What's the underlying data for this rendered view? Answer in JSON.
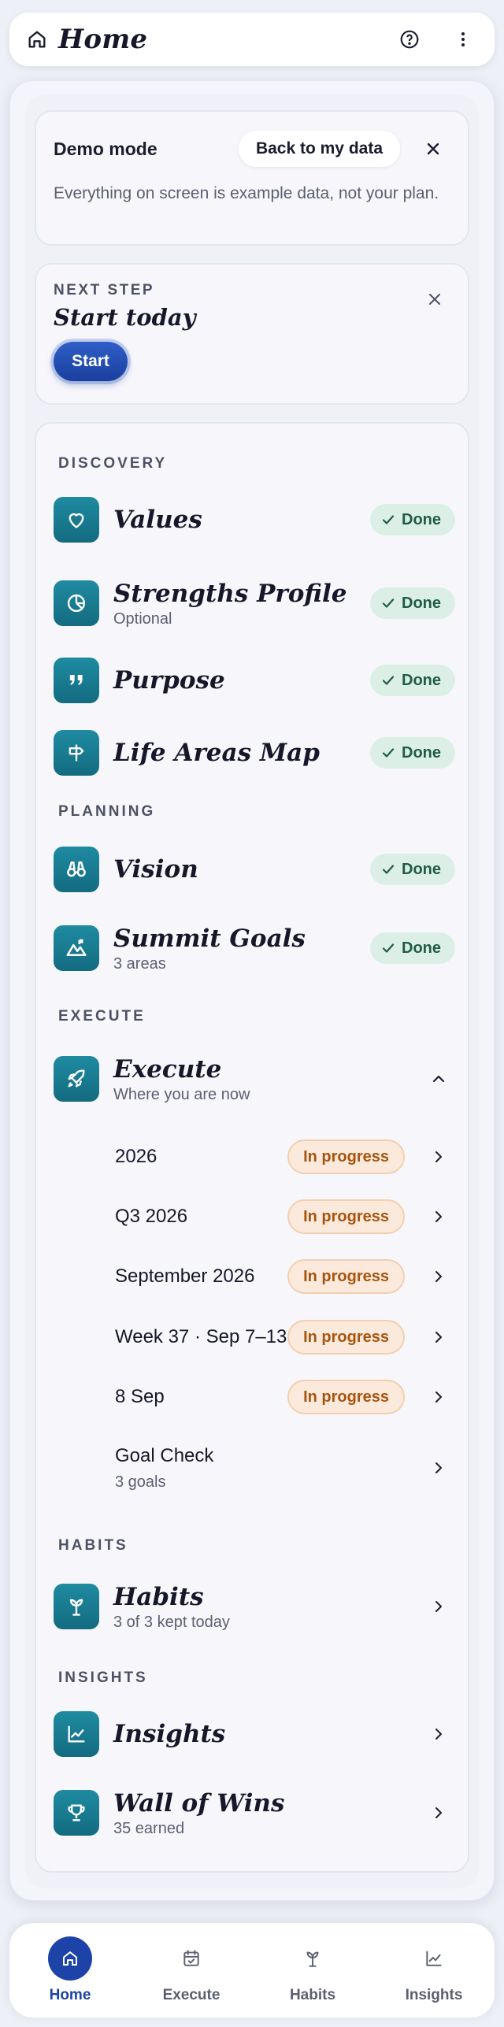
{
  "header": {
    "title": "Home",
    "home_icon": "home-icon",
    "help_icon": "help-circle-icon",
    "menu_icon": "more-vertical-icon"
  },
  "demo": {
    "title": "Demo mode",
    "back_label": "Back to my data",
    "description": "Everything on screen is example data, not your plan."
  },
  "next_step": {
    "eyebrow": "NEXT STEP",
    "title": "Start today",
    "start_label": "Start"
  },
  "sections": {
    "discovery": "DISCOVERY",
    "planning": "PLANNING",
    "execute": "EXECUTE",
    "habits": "HABITS",
    "insights": "INSIGHTS"
  },
  "items": {
    "values": {
      "name": "Values",
      "status": "Done",
      "icon": "heart-icon"
    },
    "strengths": {
      "name": "Strengths Profile",
      "sub": "Optional",
      "status": "Done",
      "icon": "palette-icon"
    },
    "purpose": {
      "name": "Purpose",
      "status": "Done",
      "icon": "quote-icon"
    },
    "life_areas": {
      "name": "Life Areas Map",
      "status": "Done",
      "icon": "signpost-icon"
    },
    "vision": {
      "name": "Vision",
      "status": "Done",
      "icon": "binoculars-icon"
    },
    "summit": {
      "name": "Summit Goals",
      "sub": "3 areas",
      "status": "Done",
      "icon": "mountain-icon"
    },
    "execute": {
      "name": "Execute",
      "sub": "Where you are now",
      "icon": "rocket-icon"
    },
    "habits": {
      "name": "Habits",
      "sub": "3 of 3 kept today",
      "icon": "sprout-icon"
    },
    "insights": {
      "name": "Insights",
      "icon": "chart-line-icon"
    },
    "wins": {
      "name": "Wall of Wins",
      "sub": "35 earned",
      "icon": "trophy-icon"
    }
  },
  "execute_children": [
    {
      "label": "2026",
      "status": "In progress"
    },
    {
      "label": "Q3 2026",
      "status": "In progress"
    },
    {
      "label": "September 2026",
      "status": "In progress"
    },
    {
      "label": "Week 37 · Sep 7–13",
      "status": "In progress"
    },
    {
      "label": "8 Sep",
      "status": "In progress"
    },
    {
      "label": "Goal Check",
      "sub": "3 goals"
    }
  ],
  "nav": [
    {
      "label": "Home",
      "icon": "home-icon",
      "active": true
    },
    {
      "label": "Execute",
      "icon": "calendar-check-icon"
    },
    {
      "label": "Habits",
      "icon": "sprout-icon"
    },
    {
      "label": "Insights",
      "icon": "chart-line-icon"
    }
  ],
  "colors": {
    "accent": "#1e43a8",
    "tile": "#1a7d93",
    "done_bg": "#dcefe7",
    "progress_bg": "#fbeadb"
  }
}
